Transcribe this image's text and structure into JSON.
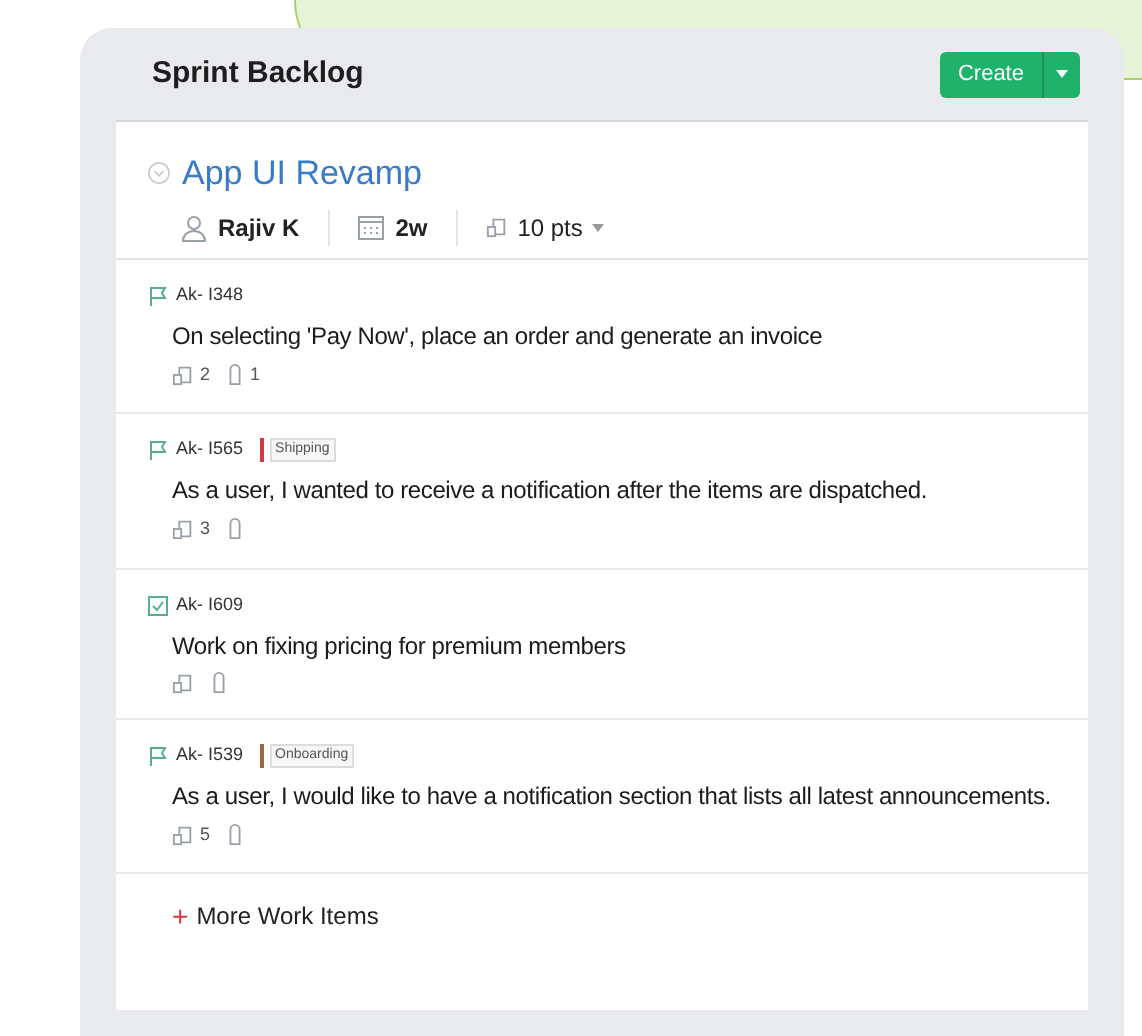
{
  "header": {
    "title": "Sprint Backlog",
    "create_button": "Create"
  },
  "sprint": {
    "name": "App UI Revamp",
    "owner": "Rajiv K",
    "duration": "2w",
    "points": "10 pts"
  },
  "items": [
    {
      "kind": "story",
      "id": "Ak- I348",
      "title": "On selecting 'Pay Now', place an order and generate an invoice",
      "points": "2",
      "attachments": "1"
    },
    {
      "kind": "story",
      "id": "Ak- I565",
      "tag": {
        "label": "Shipping",
        "color": "#d9363e"
      },
      "title": "As a user, I wanted to receive a notification after the items are dispatched.",
      "points": "3"
    },
    {
      "kind": "task",
      "id": "Ak- I609",
      "title": "Work on fixing pricing for premium members"
    },
    {
      "kind": "story",
      "id": "Ak- I539",
      "tag": {
        "label": "Onboarding",
        "color": "#9a6a3c"
      },
      "title": "As a user, I would like to have a notification section that lists all latest announcements.",
      "points": "5"
    }
  ],
  "more_link": {
    "icon": "+",
    "label": "More Work Items"
  }
}
